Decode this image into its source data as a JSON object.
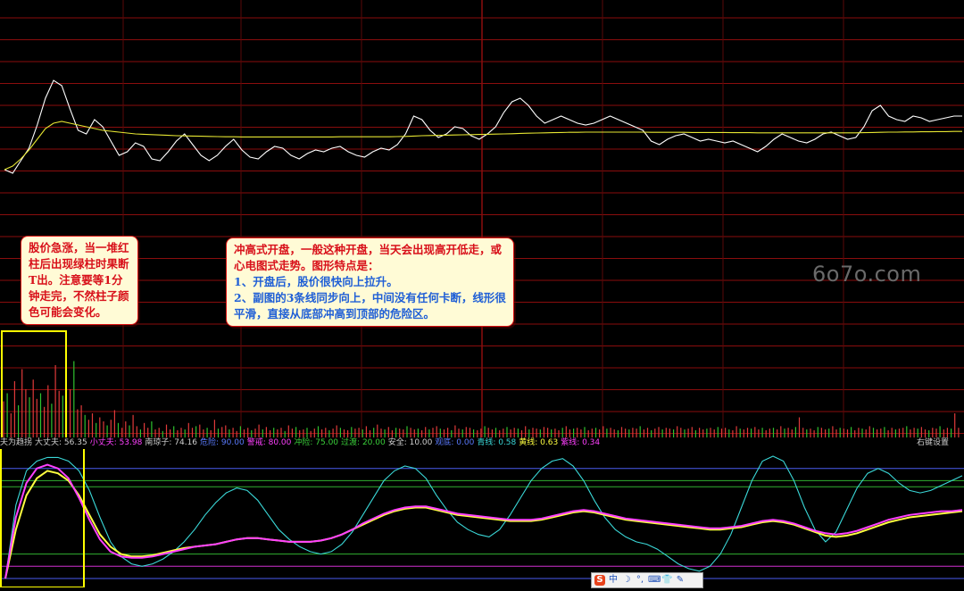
{
  "annotations": {
    "left_note": "股价急涨，当一堆红柱后出现绿柱时果断T出。注意要等1分钟走完，不然柱子颜色可能会变化。",
    "main_title": "冲高式开盘，一般这种开盘，当天会出现高开低走，或心电图式走势。图形特点是：",
    "main_point1": "1、开盘后，股价很快向上拉升。",
    "main_point2": "2、副图的3条线同步向上，中间没有任何卡断，线形很平滑，直接从底部冲高到顶部的危险区。"
  },
  "watermark": "6o7o.com",
  "indicator_bar": {
    "items": [
      {
        "label": "夫为趋拐",
        "value": "",
        "color": "#d0d0d0"
      },
      {
        "label": "大丈夫:",
        "value": "56.35",
        "color": "#d0d0d0"
      },
      {
        "label": "小丈夫:",
        "value": "53.98",
        "color": "#ff40ff"
      },
      {
        "label": "南琼子:",
        "value": "74.16",
        "color": "#d0d0d0"
      },
      {
        "label": "危险:",
        "value": "90.00",
        "color": "#5a7bff"
      },
      {
        "label": "警戒:",
        "value": "80.00",
        "color": "#ff40ff"
      },
      {
        "label": "冲险:",
        "value": "75.00",
        "color": "#3ad13a"
      },
      {
        "label": "过渡:",
        "value": "20.00",
        "color": "#3ad13a"
      },
      {
        "label": "安全:",
        "value": "10.00",
        "color": "#d0d0d0"
      },
      {
        "label": "观底:",
        "value": "0.00",
        "color": "#5a7bff"
      },
      {
        "label": "青线:",
        "value": "0.58",
        "color": "#3ad8d8"
      },
      {
        "label": "黄线:",
        "value": "0.63",
        "color": "#ffff40"
      },
      {
        "label": "紫线:",
        "value": "0.34",
        "color": "#ff40ff"
      }
    ],
    "right_setting": "右键设置"
  },
  "toolbar": {
    "items": [
      {
        "name": "sogou-icon",
        "glyph": "S"
      },
      {
        "name": "chinese-mode-icon",
        "glyph": "中"
      },
      {
        "name": "moon-icon",
        "glyph": "☽"
      },
      {
        "name": "punctuation-icon",
        "glyph": "°,"
      },
      {
        "name": "keyboard-icon",
        "glyph": "⌨"
      },
      {
        "name": "skin-icon",
        "glyph": "👕"
      },
      {
        "name": "tools-icon",
        "glyph": "✎"
      }
    ]
  },
  "chart_data": [
    {
      "type": "line",
      "panel": "intraday price",
      "series": [
        {
          "key": "price",
          "color": "#ffffff",
          "values": [
            50,
            48,
            55,
            62,
            75,
            90,
            100,
            97,
            84,
            72,
            70,
            78,
            74,
            66,
            58,
            60,
            65,
            63,
            56,
            55,
            60,
            66,
            70,
            64,
            58,
            55,
            58,
            63,
            67,
            61,
            57,
            56,
            60,
            63,
            62,
            58,
            56,
            59,
            61,
            60,
            62,
            63,
            60,
            58,
            57,
            60,
            62,
            61,
            64,
            70,
            80,
            78,
            72,
            68,
            70,
            74,
            73,
            69,
            67,
            70,
            74,
            82,
            88,
            90,
            86,
            80,
            76,
            78,
            80,
            78,
            76,
            75,
            76,
            78,
            80,
            78,
            76,
            74,
            72,
            66,
            64,
            67,
            69,
            70,
            68,
            66,
            67,
            66,
            65,
            66,
            64,
            62,
            60,
            63,
            67,
            70,
            68,
            66,
            65,
            67,
            70,
            71,
            69,
            67,
            68,
            74,
            83,
            86,
            80,
            78,
            77,
            80,
            79,
            77,
            78,
            79,
            80,
            80
          ]
        },
        {
          "key": "avg_price",
          "color": "#e6e632",
          "values": [
            50,
            52,
            56,
            61,
            67,
            73,
            76,
            77,
            76,
            75,
            74,
            73,
            72,
            71.5,
            71,
            70.5,
            70,
            69.8,
            69.6,
            69.4,
            69.2,
            69,
            68.9,
            68.8,
            68.7,
            68.6,
            68.5,
            68.4,
            68.4,
            68.3,
            68.3,
            68.3,
            68.3,
            68.3,
            68.3,
            68.3,
            68.3,
            68.3,
            68.3,
            68.3,
            68.3,
            68.4,
            68.4,
            68.4,
            68.4,
            68.4,
            68.4,
            68.4,
            68.5,
            68.6,
            68.8,
            69,
            69.1,
            69.2,
            69.3,
            69.4,
            69.5,
            69.6,
            69.7,
            69.8,
            69.9,
            70,
            70.1,
            70.3,
            70.4,
            70.5,
            70.6,
            70.7,
            70.8,
            70.9,
            70.9,
            71,
            71,
            71,
            71,
            71,
            71,
            71,
            71,
            70.9,
            70.9,
            70.9,
            70.9,
            70.9,
            70.8,
            70.8,
            70.8,
            70.8,
            70.8,
            70.7,
            70.7,
            70.7,
            70.6,
            70.6,
            70.6,
            70.6,
            70.6,
            70.6,
            70.6,
            70.6,
            70.6,
            70.6,
            70.6,
            70.6,
            70.6,
            70.7,
            70.8,
            70.9,
            71,
            71,
            71.1,
            71.1,
            71.2,
            71.2,
            71.3,
            71.3,
            71.4,
            71.4
          ]
        }
      ]
    },
    {
      "type": "bar",
      "panel": "volume",
      "values": [
        45,
        55,
        30,
        70,
        40,
        85,
        60,
        50,
        72,
        48,
        55,
        38,
        65,
        42,
        90,
        58,
        52,
        46,
        60,
        95,
        35,
        40,
        28,
        22,
        30,
        18,
        25,
        20,
        15,
        22,
        34,
        18,
        12,
        20,
        15,
        28,
        14,
        10,
        18,
        12,
        20,
        10,
        12,
        8,
        16,
        10,
        14,
        9,
        12,
        10,
        18,
        12,
        14,
        16,
        10,
        12,
        9,
        22,
        11,
        13,
        15,
        10,
        12,
        8,
        14,
        10,
        12,
        9,
        11,
        16,
        10,
        13,
        9,
        12,
        10,
        12,
        8,
        15,
        11,
        13,
        9,
        10,
        12,
        8,
        11,
        14,
        10,
        12,
        9,
        11,
        15,
        12,
        10,
        9,
        13,
        11,
        12,
        10,
        14,
        9,
        12,
        16,
        11,
        10,
        13,
        9,
        12,
        11,
        10,
        14,
        12,
        10,
        11,
        9,
        13,
        10,
        12,
        14,
        11,
        10,
        12,
        9,
        15,
        11,
        10,
        13,
        12,
        10,
        9,
        11,
        14,
        12,
        10,
        12,
        9,
        11,
        13,
        10,
        12,
        11,
        9,
        14,
        10,
        12,
        11,
        10,
        13,
        12,
        10,
        11,
        9,
        12,
        14,
        10,
        11,
        12,
        10,
        13,
        9,
        11,
        12,
        10,
        14,
        11,
        12,
        10,
        9,
        13,
        11,
        10,
        12,
        11,
        14,
        10,
        12,
        9,
        11,
        13,
        10,
        12,
        11,
        10,
        14,
        12,
        10,
        11,
        13,
        9,
        12,
        10,
        11,
        12,
        10,
        13,
        11,
        12,
        10,
        9,
        14,
        11,
        10,
        12,
        11,
        13,
        10,
        12,
        9,
        11,
        12,
        10,
        14,
        11,
        12,
        10,
        13,
        25,
        12,
        10,
        11,
        9,
        13,
        12,
        10,
        11,
        14,
        10,
        12,
        11,
        10,
        13,
        9,
        12,
        11,
        10,
        14,
        12,
        10,
        11,
        13,
        9,
        12,
        10,
        11,
        12,
        14,
        10,
        12,
        11,
        13,
        10,
        9,
        12,
        11,
        14,
        10,
        12,
        11,
        30,
        12
      ]
    },
    {
      "type": "line",
      "panel": "sub indicator",
      "levels": [
        90,
        80,
        75,
        20,
        10,
        0
      ],
      "series": [
        {
          "key": "cyan",
          "color": "#3ad8d8",
          "values": [
            0,
            60,
            88,
            96,
            99,
            99,
            96,
            88,
            72,
            50,
            30,
            18,
            12,
            10,
            12,
            16,
            22,
            30,
            40,
            52,
            62,
            70,
            74,
            72,
            64,
            52,
            40,
            32,
            26,
            22,
            20,
            22,
            28,
            38,
            52,
            66,
            80,
            88,
            92,
            90,
            82,
            68,
            56,
            46,
            40,
            36,
            34,
            40,
            52,
            66,
            80,
            90,
            96,
            98,
            92,
            80,
            64,
            50,
            40,
            34,
            30,
            28,
            24,
            18,
            12,
            8,
            6,
            10,
            20,
            36,
            58,
            80,
            96,
            100,
            96,
            80,
            58,
            40,
            30,
            38,
            56,
            74,
            86,
            90,
            86,
            78,
            72,
            70,
            72,
            76,
            80,
            84
          ]
        },
        {
          "key": "yellow",
          "color": "#ffff40",
          "values": [
            0,
            40,
            68,
            82,
            88,
            86,
            80,
            68,
            52,
            36,
            26,
            20,
            18,
            18,
            19,
            21,
            23,
            25,
            26,
            27,
            28,
            30,
            32,
            33,
            33,
            32,
            31,
            30,
            30,
            30,
            31,
            33,
            36,
            40,
            44,
            48,
            52,
            55,
            57,
            58,
            58,
            56,
            54,
            52,
            51,
            50,
            49,
            48,
            47,
            47,
            47,
            48,
            50,
            52,
            54,
            55,
            54,
            52,
            50,
            48,
            47,
            46,
            45,
            44,
            43,
            42,
            41,
            40,
            40,
            41,
            42,
            44,
            46,
            47,
            46,
            44,
            41,
            38,
            35,
            34,
            35,
            37,
            40,
            43,
            46,
            48,
            50,
            51,
            52,
            53,
            54,
            55
          ]
        },
        {
          "key": "magenta",
          "color": "#ff40ff",
          "values": [
            0,
            50,
            78,
            90,
            93,
            90,
            82,
            66,
            48,
            32,
            22,
            18,
            17,
            17,
            18,
            20,
            22,
            24,
            26,
            27,
            28,
            30,
            32,
            33,
            33,
            32,
            31,
            30,
            30,
            30,
            31,
            33,
            36,
            40,
            45,
            49,
            53,
            56,
            58,
            59,
            59,
            57,
            55,
            53,
            52,
            51,
            50,
            49,
            48,
            48,
            48,
            49,
            51,
            53,
            55,
            56,
            55,
            53,
            51,
            49,
            48,
            47,
            46,
            45,
            44,
            43,
            42,
            41,
            41,
            42,
            43,
            45,
            47,
            48,
            47,
            45,
            42,
            39,
            37,
            36,
            37,
            39,
            42,
            45,
            48,
            50,
            52,
            53,
            54,
            55,
            55,
            56
          ]
        }
      ]
    }
  ],
  "colors": {
    "grid_red": "#8a0d0d",
    "grid_red_dim": "#5a0808",
    "volume_red": "#e03a3a",
    "volume_green": "#2fc22f",
    "highlight_box": "#ffff00",
    "level_blue": "#4a5cf0",
    "level_green": "#30b030",
    "level_magenta": "#d030d0"
  }
}
